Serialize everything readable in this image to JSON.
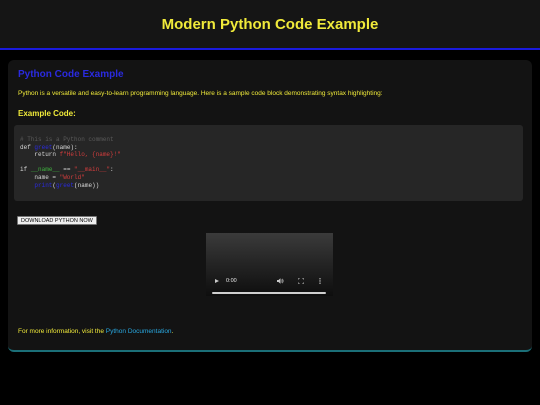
{
  "header": {
    "title": "Modern Python Code Example"
  },
  "main": {
    "section_title": "Python Code Example",
    "intro": "Python is a versatile and easy-to-learn programming language. Here is a sample code block demonstrating syntax highlighting:",
    "code_heading": "Example Code:",
    "code_lines": [
      [
        {
          "t": "# This is a Python comment",
          "k": "comment"
        }
      ],
      [
        {
          "t": "def ",
          "k": "keyword"
        },
        {
          "t": "greet",
          "k": "func"
        },
        {
          "t": "(name):",
          "k": "plain"
        }
      ],
      [
        {
          "t": "    return ",
          "k": "keyword"
        },
        {
          "t": "f\"Hello, {name}!\"",
          "k": "string"
        }
      ],
      [
        {
          "t": "",
          "k": "plain"
        }
      ],
      [
        {
          "t": "if ",
          "k": "keyword"
        },
        {
          "t": "__name__",
          "k": "dunder"
        },
        {
          "t": " == ",
          "k": "plain"
        },
        {
          "t": "\"__main__\"",
          "k": "string"
        },
        {
          "t": ":",
          "k": "plain"
        }
      ],
      [
        {
          "t": "    name = ",
          "k": "plain"
        },
        {
          "t": "\"World\"",
          "k": "string"
        }
      ],
      [
        {
          "t": "    ",
          "k": "plain"
        },
        {
          "t": "print",
          "k": "func"
        },
        {
          "t": "(",
          "k": "plain"
        },
        {
          "t": "greet",
          "k": "func"
        },
        {
          "t": "(name))",
          "k": "plain"
        }
      ]
    ],
    "download_button": "DOWNLOAD PYTHON NOW",
    "video": {
      "time": "0:00",
      "progress": 0
    },
    "footer_prefix": "For more information, visit the ",
    "footer_link": "Python Documentation",
    "footer_suffix": "."
  },
  "colors": {
    "title_yellow": "#f0ea3a",
    "heading_blue": "#2a2ae0",
    "link_blue": "#29a8e0",
    "string_red": "#d23d3d",
    "dunder_green": "#3fb23f",
    "header_border": "#1a1adc"
  }
}
